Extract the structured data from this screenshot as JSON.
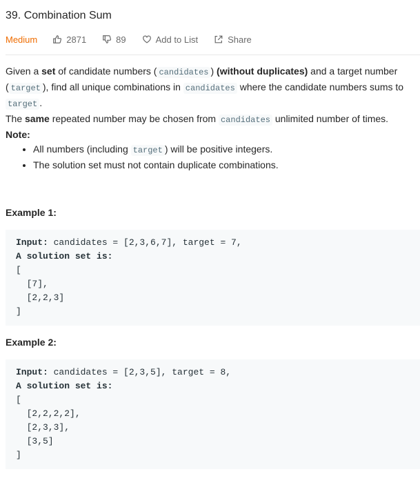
{
  "problem": {
    "title": "39. Combination Sum",
    "difficulty": "Medium",
    "likes": "2871",
    "dislikes": "89",
    "add_to_list_label": "Add to List",
    "share_label": "Share"
  },
  "description": {
    "p1_a": "Given a ",
    "p1_set": "set",
    "p1_b": " of candidate numbers (",
    "p1_code1": "candidates",
    "p1_c": ") ",
    "p1_nodup": "(without duplicates)",
    "p1_d": " and a target number (",
    "p1_code2": "target",
    "p1_e": "), find all unique combinations in ",
    "p1_code3": "candidates",
    "p1_f": " where the candidate numbers sums to ",
    "p1_code4": "target",
    "p1_g": ".",
    "p2_a": "The ",
    "p2_same": "same",
    "p2_b": " repeated number may be chosen from ",
    "p2_code": "candidates",
    "p2_c": " unlimited number of times.",
    "note_head": "Note:",
    "note1_a": "All numbers (including ",
    "note1_code": "target",
    "note1_b": ") will be positive integers.",
    "note2": "The solution set must not contain duplicate combinations."
  },
  "examples": [
    {
      "heading": "Example 1:",
      "input_label": "Input:",
      "input_value": " candidates = [2,3,6,7], target = 7,",
      "solution_label": "A solution set is:",
      "body": "[\n  [7],\n  [2,2,3]\n]"
    },
    {
      "heading": "Example 2:",
      "input_label": "Input:",
      "input_value": " candidates = [2,3,5], target = 8,",
      "solution_label": "A solution set is:",
      "body": "[\n  [2,2,2,2],\n  [2,3,3],\n  [3,5]\n]"
    }
  ],
  "colors": {
    "difficulty_medium": "#ef6c00",
    "code_background": "#f7f9fa",
    "text": "#262626"
  },
  "icons": [
    "thumbs-up-icon",
    "thumbs-down-icon",
    "heart-icon",
    "share-icon"
  ]
}
